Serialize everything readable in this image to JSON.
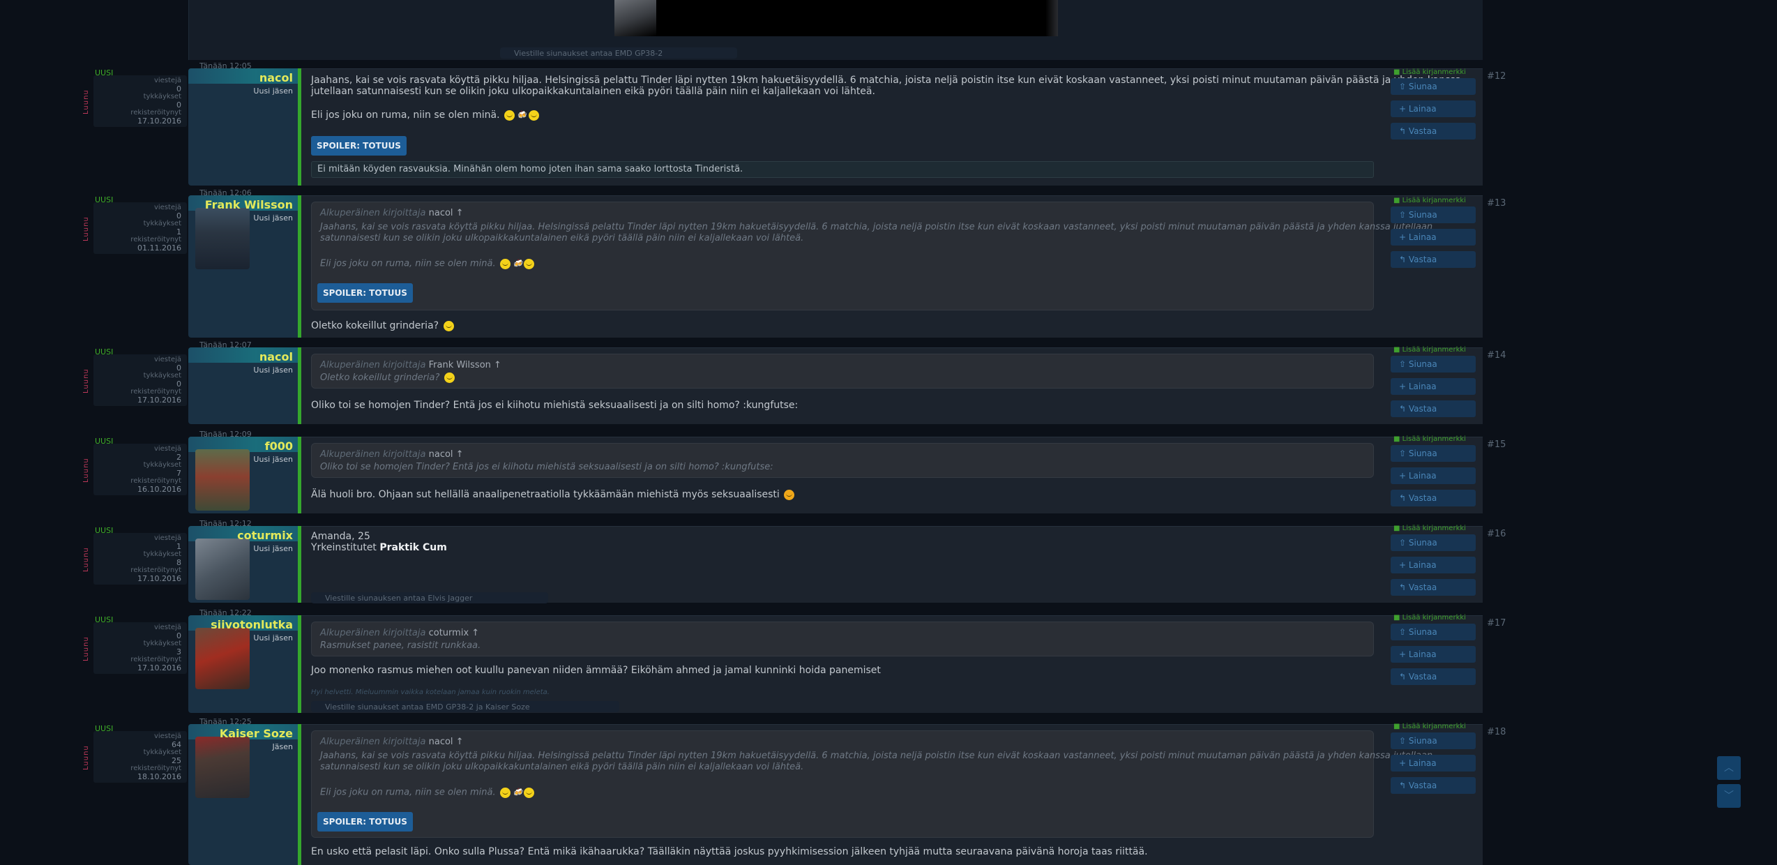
{
  "colors": {
    "bg": "#0b1018",
    "name": "#e3e95a",
    "accent_green": "#35a72d",
    "button_blue": "#1d5d97",
    "side_button": "#173452"
  },
  "common": {
    "uusi": "UUSI",
    "luunu": "Luunu",
    "stat_viestit": "viestejä",
    "stat_tykkaykset": "tykkäykset",
    "stat_rekisteroitynyt": "rekisteröitynyt",
    "bookmark": "Lisää kirjanmerkki",
    "btn_siunaa": "Siunaa",
    "btn_lainaa": "Lainaa",
    "btn_vastaa": "Vastaa",
    "spoiler": "SPOILER: TOTUUS",
    "quote_prefix": "Alkuperäinen kirjoittaja"
  },
  "top": {
    "thanks": "Viestille siunaukset antaa EMD GP38-2"
  },
  "posts": [
    {
      "num": "#12",
      "time": "Tänään 12:05",
      "username": "nacol",
      "role": "Uusi jäsen",
      "stats": [
        "viestejä",
        "0",
        "tykkäykset",
        "0",
        "rekisteröitynyt",
        "17.10.2016"
      ],
      "text1": "Jaahans, kai se vois rasvata köyttä pikku hiljaa. Helsingissä pelattu Tinder läpi nytten 19km hakuetäisyydellä. 6 matchia, joista neljä poistin itse kun eivät koskaan vastanneet, yksi poisti minut muutaman päivän päästä ja yhden kanssa",
      "text2": "jutellaan satunnaisesti kun se olikin joku ulkopaikkakuntalainen eikä pyöri täällä päin niin ei kaljallekaan voi lähteä.",
      "text3": "Eli jos joku on ruma, niin se olen minä.",
      "spoiler_text": "Ei mitään köyden rasvauksia. Minähän olem homo joten ihan sama saako lorttosta Tinderistä."
    },
    {
      "num": "#13",
      "time": "Tänään 12:06",
      "username": "Frank Wilsson",
      "role": "Uusi jäsen",
      "stats": [
        "viestejä",
        "0",
        "tykkäykset",
        "1",
        "rekisteröitynyt",
        "01.11.2016"
      ],
      "quote_author": "nacol",
      "quote1": "Jaahans, kai se vois rasvata köyttä pikku hiljaa. Helsingissä pelattu Tinder läpi nytten 19km hakuetäisyydellä. 6 matchia, joista neljä poistin itse kun eivät koskaan vastanneet, yksi poisti minut muutaman päivän päästä ja yhden kanssa jutellaan",
      "quote2": "satunnaisesti kun se olikin joku ulkopaikkakuntalainen eikä pyöri täällä päin niin ei kaljallekaan voi lähteä.",
      "quote3": "Eli jos joku on ruma, niin se olen minä.",
      "text1": "Oletko kokeillut grinderia?"
    },
    {
      "num": "#14",
      "time": "Tänään 12:07",
      "username": "nacol",
      "role": "Uusi jäsen",
      "stats": [
        "viestejä",
        "0",
        "tykkäykset",
        "0",
        "rekisteröitynyt",
        "17.10.2016"
      ],
      "quote_author": "Frank Wilsson",
      "quote1": "Oletko kokeillut grinderia?",
      "text1": "Oliko toi se homojen Tinder? Entä jos ei kiihotu miehistä seksuaalisesti ja on silti homo? :kungfutse:"
    },
    {
      "num": "#15",
      "time": "Tänään 12:09",
      "username": "f000",
      "role": "Uusi jäsen",
      "stats": [
        "viestejä",
        "2",
        "tykkäykset",
        "7",
        "rekisteröitynyt",
        "16.10.2016"
      ],
      "quote_author": "nacol",
      "quote1": "Oliko toi se homojen Tinder? Entä jos ei kiihotu miehistä seksuaalisesti ja on silti homo? :kungfutse:",
      "text1": "Älä huoli bro. Ohjaan sut hellällä anaalipenetraatiolla tykkäämään miehistä myös seksuaalisesti"
    },
    {
      "num": "#16",
      "time": "Tänään 12:12",
      "username": "coturmix",
      "role": "Uusi jäsen",
      "stats": [
        "viestejä",
        "1",
        "tykkäykset",
        "8",
        "rekisteröitynyt",
        "17.10.2016"
      ],
      "text1": "Amanda, 25",
      "text2a": "Yrkeinstitutet",
      "text2b": "Praktik Cum",
      "thanks": "Viestille siunauksen antaa Elvis Jagger"
    },
    {
      "num": "#17",
      "time": "Tänään 12:22",
      "username": "siivotonlutka",
      "role": "Uusi jäsen",
      "stats": [
        "viestejä",
        "0",
        "tykkäykset",
        "3",
        "rekisteröitynyt",
        "17.10.2016"
      ],
      "quote_author": "coturmix",
      "quote1": "Rasmukset panee, rasistit runkkaa.",
      "text1": "Joo monenko rasmus miehen oot kuullu panevan niiden ämmää? Eiköhäm ahmed ja jamal kunninki hoida panemiset",
      "sig": "Hyi helvetti. Mieluummin vaikka kotelaan jamaa kuin ruokin meleta.",
      "thanks": "Viestille siunaukset antaa EMD GP38-2 ja Kaiser Soze"
    },
    {
      "num": "#18",
      "time": "Tänään 12:25",
      "username": "Kaiser Soze",
      "role": "Jäsen",
      "stats": [
        "viestejä",
        "64",
        "tykkäykset",
        "25",
        "rekisteröitynyt",
        "18.10.2016"
      ],
      "quote_author": "nacol",
      "quote1": "Jaahans, kai se vois rasvata köyttä pikku hiljaa. Helsingissä pelattu Tinder läpi nytten 19km hakuetäisyydellä. 6 matchia, joista neljä poistin itse kun eivät koskaan vastanneet, yksi poisti minut muutaman päivän päästä ja yhden kanssa jutellaan",
      "quote2": "satunnaisesti kun se olikin joku ulkopaikkakuntalainen eikä pyöri täällä päin niin ei kaljallekaan voi lähteä.",
      "quote3": "Eli jos joku on ruma, niin se olen minä.",
      "text1": "En usko että pelasit läpi. Onko sulla Plussa? Entä mikä ikähaarukka? Täälläkin näyttää joskus pyyhkimisession jälkeen tyhjää mutta seuraavana päivänä horoja taas riittää."
    }
  ]
}
